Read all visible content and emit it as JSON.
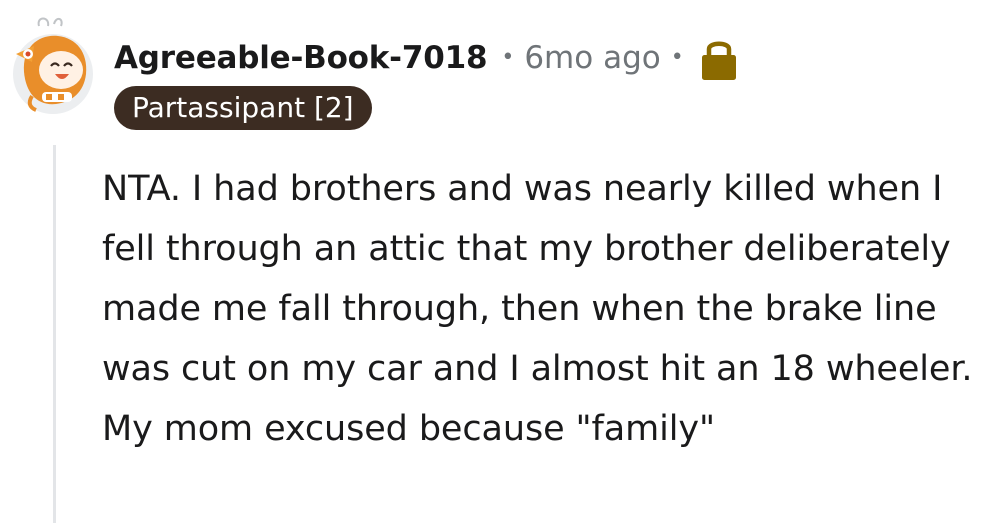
{
  "comment": {
    "username": "Agreeable-Book-7018",
    "separator": "•",
    "timestamp": "6mo ago",
    "flair": "Partassipant [2]",
    "body": "NTA. I had brothers and was nearly killed when I fell through an attic that my brother deliberately made me fall through, then when the brake line was cut on my car and I almost hit an 18 wheeler. My mom excused because \"family\""
  },
  "icons": {
    "avatar": "avatar-icon",
    "lock": "lock-icon"
  },
  "colors": {
    "username": "#1a1a1b",
    "meta": "#6f7478",
    "flair_bg": "#3c2c22",
    "flair_text": "#ffffff",
    "lock": "#8b6a00",
    "thread_line": "#e3e5e8",
    "body_text": "#1a1a1b"
  }
}
